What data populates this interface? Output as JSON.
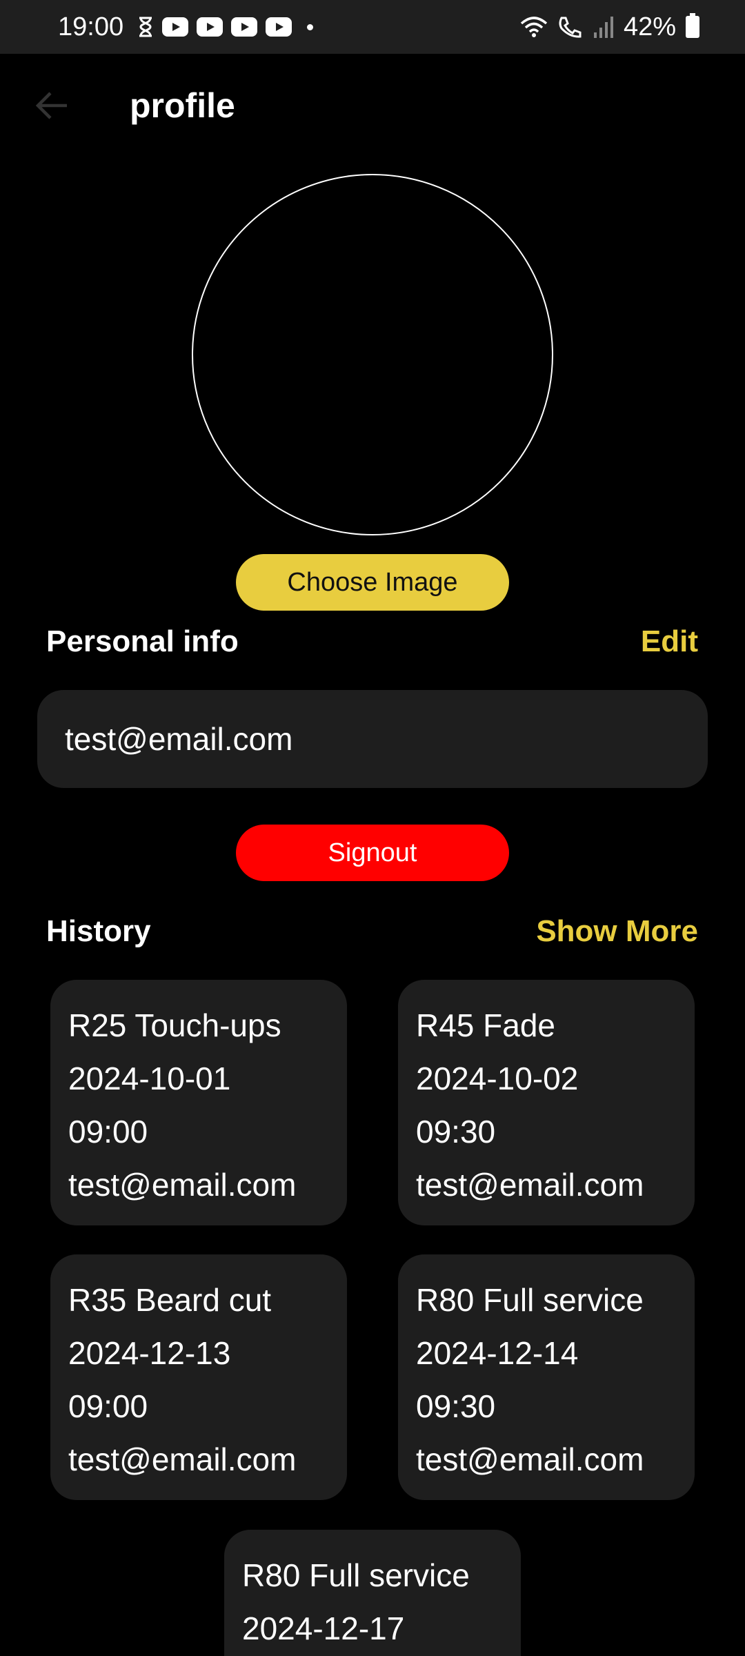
{
  "status_bar": {
    "time": "19:00",
    "battery": "42%",
    "icons": [
      "hourglass-icon",
      "youtube-icon",
      "youtube-icon",
      "youtube-icon",
      "youtube-icon",
      "dot-icon",
      "wifi-icon",
      "wifi-call-icon",
      "signal-icon",
      "battery-icon"
    ]
  },
  "header": {
    "title": "profile",
    "back_icon": "arrow-left-icon"
  },
  "avatar": {
    "choose_label": "Choose Image"
  },
  "personal_info": {
    "title": "Personal info",
    "edit_label": "Edit",
    "email_value": "test@email.com"
  },
  "signout_label": "Signout",
  "history": {
    "title": "History",
    "show_more_label": "Show More",
    "items": [
      {
        "service": "R25 Touch-ups",
        "date": "2024-10-01",
        "time": "09:00",
        "email": "test@email.com"
      },
      {
        "service": "R45 Fade",
        "date": "2024-10-02",
        "time": "09:30",
        "email": "test@email.com"
      },
      {
        "service": "R35 Beard cut",
        "date": "2024-12-13",
        "time": "09:00",
        "email": "test@email.com"
      },
      {
        "service": "R80 Full service",
        "date": "2024-12-14",
        "time": "09:30",
        "email": "test@email.com"
      },
      {
        "service": "R80 Full service",
        "date": "2024-12-17",
        "time": "",
        "email": ""
      }
    ]
  },
  "colors": {
    "accent": "#e8cd3f",
    "danger": "#ff0000",
    "card": "#1e1e1e",
    "background": "#000000"
  }
}
